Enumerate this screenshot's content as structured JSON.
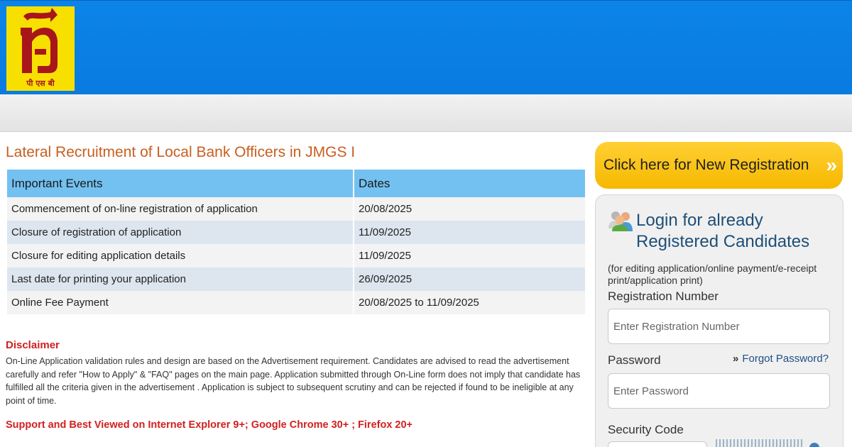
{
  "header": {
    "logo_text": "पी एस बी",
    "colors": {
      "topbar": "#0b84e8",
      "logo_bg": "#f7e000",
      "logo_mark": "#a8161c"
    }
  },
  "main": {
    "title": "Lateral Recruitment of Local Bank Officers in JMGS I",
    "table": {
      "headers": [
        "Important Events",
        "Dates"
      ],
      "rows": [
        {
          "event": "Commencement of on-line registration of application",
          "date": "20/08/2025"
        },
        {
          "event": "Closure of registration of application",
          "date": "11/09/2025"
        },
        {
          "event": "Closure for editing application details",
          "date": "11/09/2025"
        },
        {
          "event": "Last date for printing your application",
          "date": "26/09/2025"
        },
        {
          "event": "Online Fee Payment",
          "date": "20/08/2025 to 11/09/2025"
        }
      ]
    },
    "disclaimer": {
      "heading": "Disclaimer",
      "body": "On-Line Application validation rules and design are based on the Advertisement requirement. Candidates are advised to read the advertisement carefully and refer \"How to Apply\" & \"FAQ\" pages on the main page. Application submitted through On-Line form does not imply that candidate has fulfilled all the criteria given in the advertisement . Application is subject to subsequent scrutiny and can be rejected if found to be ineligible at any point of time."
    },
    "support_text": "Support and Best Viewed on Internet Explorer 9+; Google Chrome 30+ ; Firefox 20+"
  },
  "sidebar": {
    "new_registration": {
      "label": "Click here for New Registration",
      "arrow": "»"
    },
    "login": {
      "title": "Login for already Registered Candidates",
      "note": "(for editing application/online payment/e-receipt print/application print)",
      "registration_label": "Registration Number",
      "registration_placeholder": "Enter Registration Number",
      "password_label": "Password",
      "forgot_chevron": "»",
      "forgot_label": "Forgot Password?",
      "password_placeholder": "Enter Password",
      "security_label": "Security Code"
    }
  }
}
